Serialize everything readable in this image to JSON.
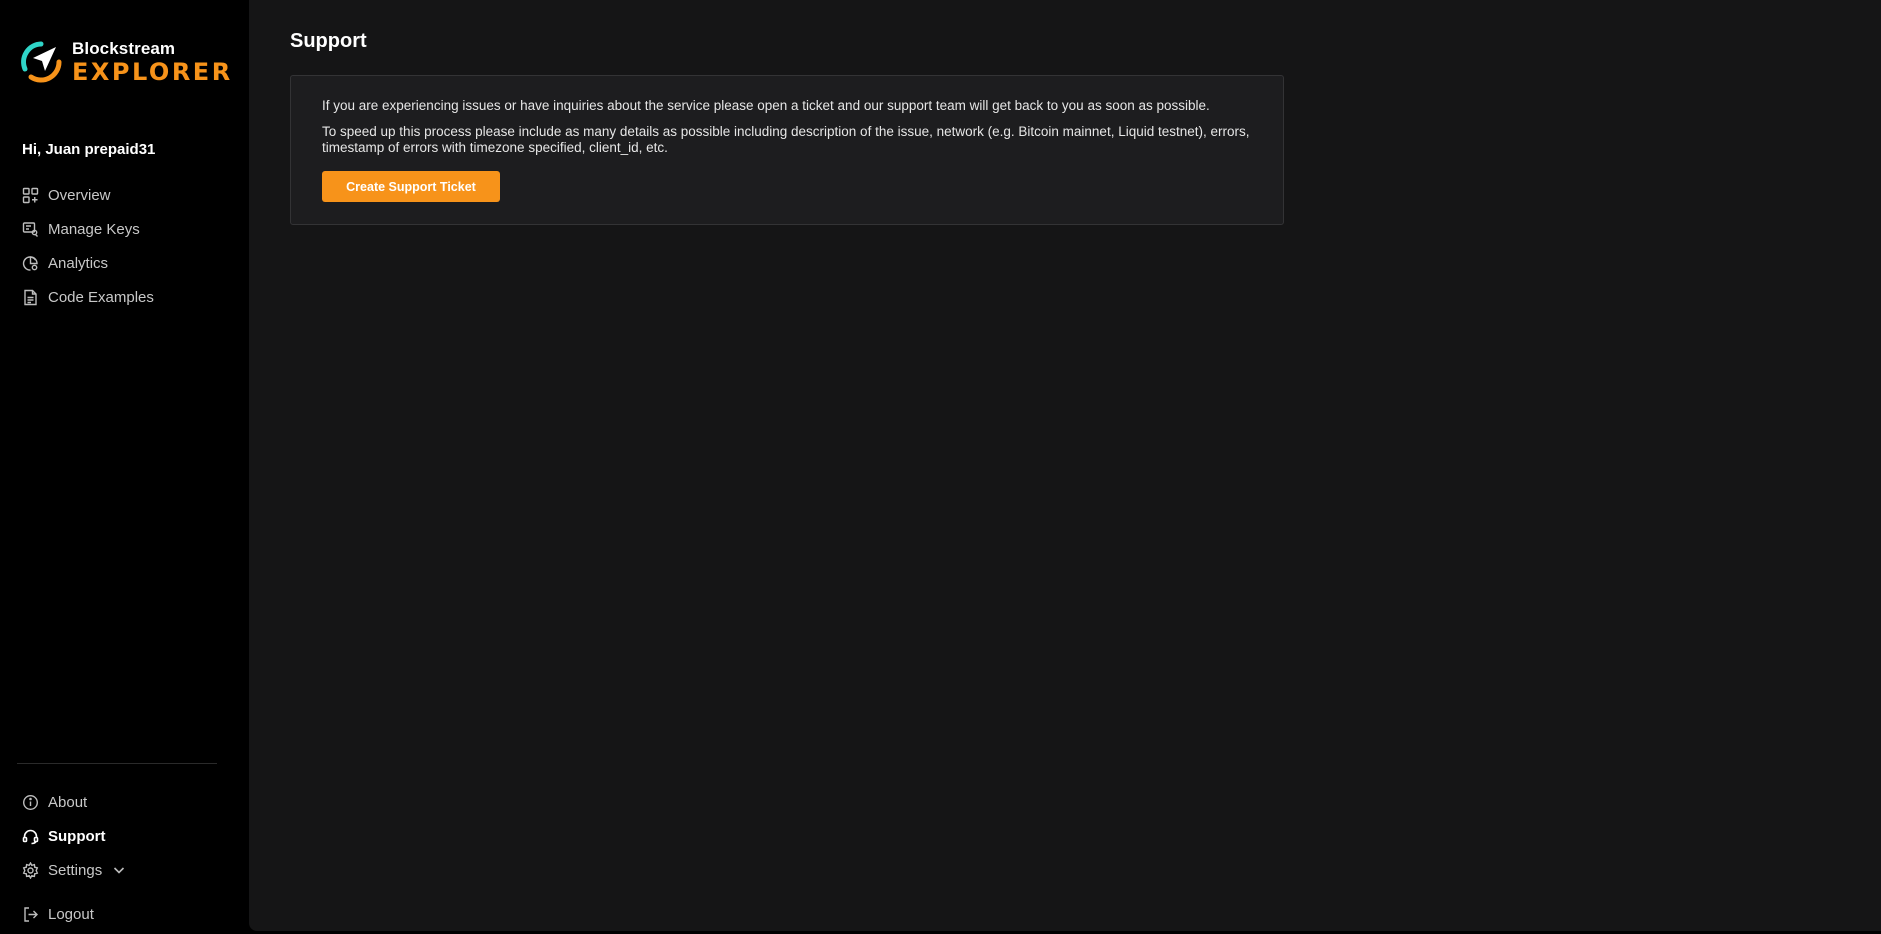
{
  "brand": {
    "name_top": "Blockstream",
    "name_bottom": "EXPLORER",
    "accent_color": "#f7931a",
    "teal_color": "#2fd5c8"
  },
  "sidebar": {
    "greeting": "Hi, Juan prepaid31",
    "items": [
      {
        "label": "Overview",
        "icon": "grid-icon"
      },
      {
        "label": "Manage Keys",
        "icon": "key-icon"
      },
      {
        "label": "Analytics",
        "icon": "analytics-icon"
      },
      {
        "label": "Code Examples",
        "icon": "document-icon"
      }
    ],
    "bottom_items": [
      {
        "label": "About",
        "icon": "info-icon"
      },
      {
        "label": "Support",
        "icon": "support-icon",
        "active": true
      },
      {
        "label": "Settings",
        "icon": "gear-icon"
      },
      {
        "label": "Logout",
        "icon": "logout-icon"
      }
    ]
  },
  "main": {
    "title": "Support",
    "paragraph_1": "If you are experiencing issues or have inquiries about the service please open a ticket and our support team will get back to you as soon as possible.",
    "paragraph_2": "To speed up this process please include as many details as possible including description of the issue, network (e.g. Bitcoin mainnet, Liquid testnet), errors, timestamp of errors with timezone specified, client_id, etc.",
    "button_label": "Create Support Ticket"
  }
}
